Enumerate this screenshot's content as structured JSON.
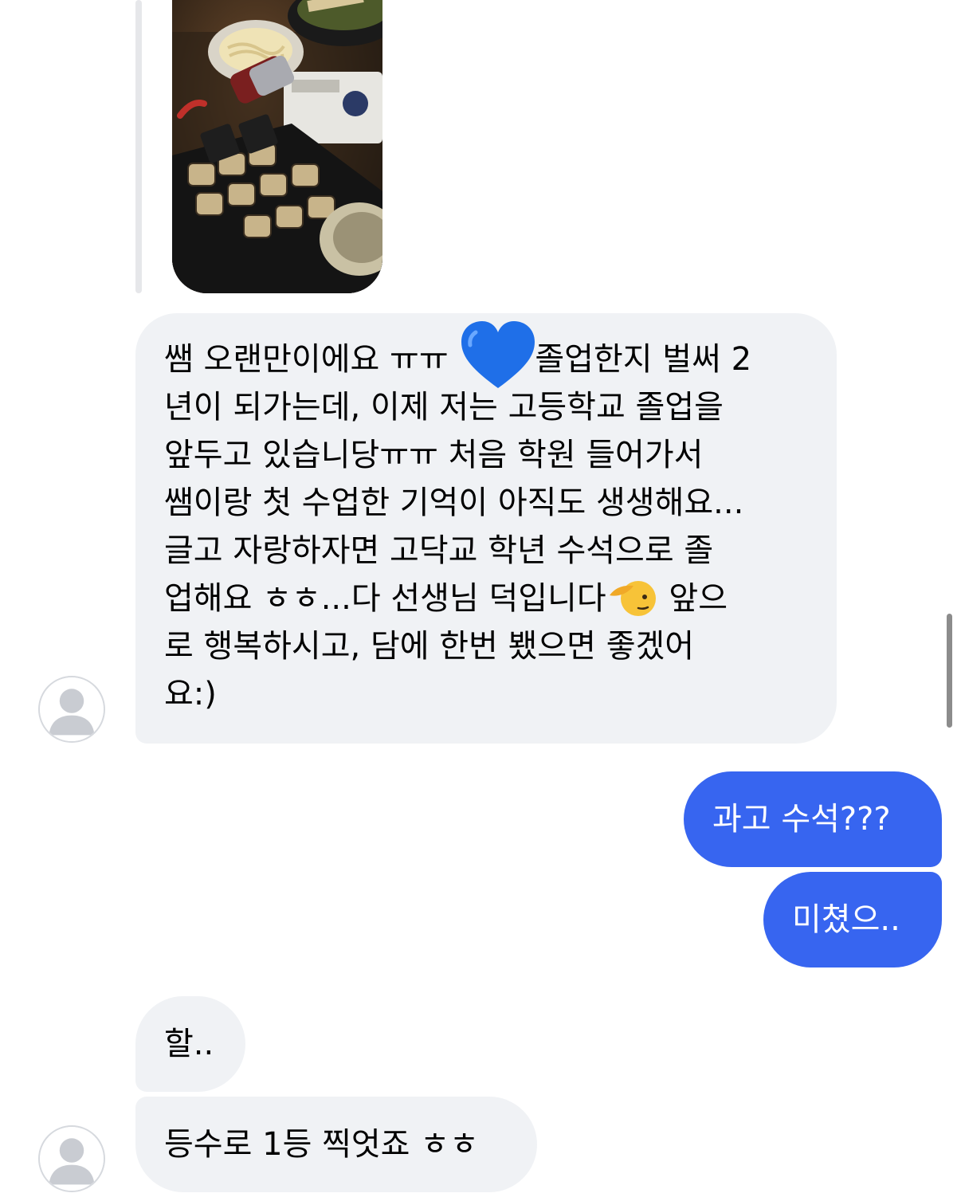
{
  "colors": {
    "incoming_bubble": "#f0f2f5",
    "outgoing_bubble": "#3765f0",
    "outgoing_text": "#ffffff",
    "incoming_text": "#000000"
  },
  "messages": {
    "long": {
      "lines": [
        {
          "before": "쌤 오랜만이에요 ㅠㅠ ",
          "emoji": "blue-heart",
          "after": "졸업한지 벌써 2"
        },
        {
          "text": "년이 되가는데, 이제 저는 고등학교 졸업을"
        },
        {
          "text": "앞두고 있습니당ㅠㅠ 처음 학원 들어가서"
        },
        {
          "text": "쌤이랑 첫 수업한 기억이 아직도 생생해요..."
        },
        {
          "text": "글고 자랑하자면 고닥교 학년 수석으로 졸"
        },
        {
          "before": "업해요 ㅎㅎ...다 선생님 덕입니다",
          "emoji": "saluting-face",
          "after": " 앞으"
        },
        {
          "text": "로 행복하시고, 담에 한번 뵀으면 좋겠어"
        },
        {
          "text": "요:)"
        }
      ]
    },
    "gwago": "과고 수석???",
    "michyeo": "미쳤으..",
    "hal": "할..",
    "deung": "등수로 1등 찍엇죠 ㅎㅎ"
  },
  "icons": {
    "avatar": "default-profile-icon",
    "heart": "blue-heart-icon",
    "salute": "saluting-face-icon"
  }
}
